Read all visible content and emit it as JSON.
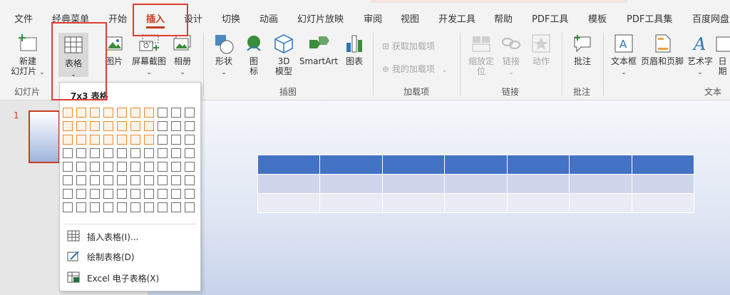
{
  "menu_tabs": [
    "文件",
    "经典菜单",
    "开始",
    "插入",
    "设计",
    "切换",
    "动画",
    "幻灯片放映",
    "审阅",
    "视图",
    "开发工具",
    "帮助",
    "PDF工具",
    "模板",
    "PDF工具集",
    "百度网盘"
  ],
  "ribbon": {
    "new_slide": "新建\n幻灯片",
    "table": "表格",
    "images": "图片",
    "screenshot": "屏幕截图",
    "album": "相册",
    "shapes": "形状",
    "icons": "图\n标",
    "model3d": "3D\n模型",
    "smartart": "SmartArt",
    "chart": "图表",
    "get_addins": "获取加载项",
    "my_addins": "我的加载项",
    "zoom": "缩放定\n位",
    "link": "链接",
    "action": "动作",
    "comment": "批注",
    "textbox": "文本框",
    "header_footer": "页眉和页脚",
    "wordart": "艺术字",
    "date": "日期"
  },
  "groups": {
    "slides": "幻灯片",
    "illustrations": "插图",
    "addins": "加载项",
    "links": "链接",
    "comments": "批注",
    "text": "文本"
  },
  "slide_panel": {
    "slide_number": "1"
  },
  "dropdown": {
    "title": "7x3 表格",
    "grid": {
      "cols": 10,
      "rows": 8,
      "selected_cols": 7,
      "selected_rows": 3
    },
    "items": [
      {
        "label": "插入表格(I)..."
      },
      {
        "label": "绘制表格(D)"
      },
      {
        "label": "Excel 电子表格(X)"
      }
    ]
  },
  "colors": {
    "accent": "#c43e1c",
    "table_header": "#4472c4",
    "highlight": "#e03c31",
    "grid_selected": "#e88a2e"
  }
}
